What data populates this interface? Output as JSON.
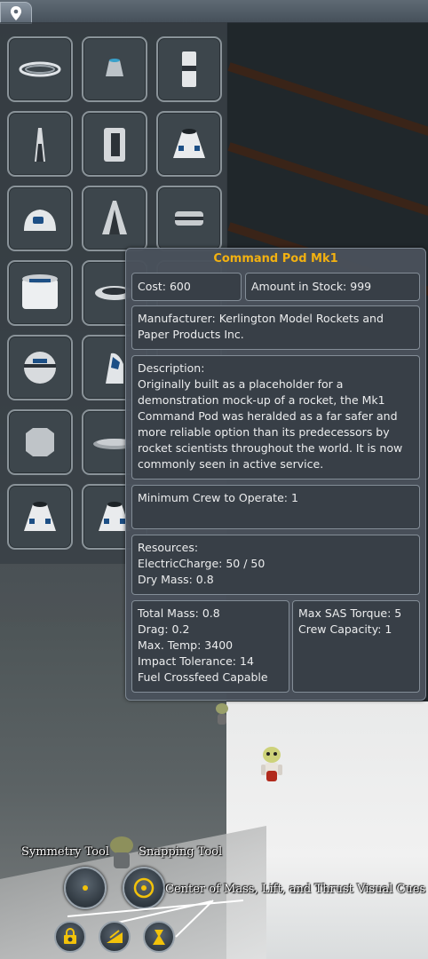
{
  "topbar": {
    "tab_icon": "map-pin-icon"
  },
  "parts": [
    {
      "name": "decoupler-ring",
      "icon": "ring"
    },
    {
      "name": "nose-cone",
      "icon": "cone-small"
    },
    {
      "name": "rcs-tank",
      "icon": "cylinder-tall"
    },
    {
      "name": "capsule-small",
      "icon": "capsule-tall"
    },
    {
      "name": "fuel-cylinder",
      "icon": "cylinder"
    },
    {
      "name": "command-pod-large",
      "icon": "pod"
    },
    {
      "name": "command-pod-lander",
      "icon": "pod-round"
    },
    {
      "name": "cockpit-cone",
      "icon": "cone"
    },
    {
      "name": "tank-disc",
      "icon": "disc"
    },
    {
      "name": "hitchhiker-module",
      "icon": "cylinder-wide"
    },
    {
      "name": "docking-ring",
      "icon": "ring-wide"
    },
    {
      "name": "",
      "icon": ""
    },
    {
      "name": "sphere-pod",
      "icon": "sphere"
    },
    {
      "name": "mk2-cockpit",
      "icon": "cockpit"
    },
    {
      "name": "",
      "icon": ""
    },
    {
      "name": "battery-pack",
      "icon": "octagon"
    },
    {
      "name": "plate",
      "icon": "plate"
    },
    {
      "name": "",
      "icon": ""
    },
    {
      "name": "command-pod-mk1",
      "icon": "pod"
    },
    {
      "name": "command-pod-mk1-alt",
      "icon": "pod"
    }
  ],
  "tooltip": {
    "title": "Command Pod Mk1",
    "cost": "Cost: 600",
    "stock": "Amount in Stock: 999",
    "manufacturer": "Manufacturer: Kerlington Model Rockets and Paper Products Inc.",
    "description_label": "Description:",
    "description": "Originally built as a placeholder for a demonstration mock-up of a rocket, the Mk1 Command Pod was heralded as a far safer and more reliable option than its predecessors by rocket scientists throughout the world. It is now commonly seen in active service.",
    "min_crew": "Minimum Crew to Operate: 1",
    "resources_label": "Resources:",
    "electric": "ElectricCharge: 50 / 50",
    "dry_mass": "Dry Mass: 0.8",
    "stats_left": [
      "Total Mass: 0.8",
      "Drag: 0.2",
      "Max. Temp: 3400",
      "Impact Tolerance: 14",
      "Fuel Crossfeed Capable"
    ],
    "stats_right": [
      "Max SAS Torque: 5",
      "Crew Capacity: 1"
    ]
  },
  "tools": {
    "symmetry_label": "Symmetry Tool",
    "snapping_label": "Snapping Tool",
    "cues_label": "Center of Mass, Lift, and Thrust Visual Cues",
    "com_icon": "center-of-mass-icon",
    "col_icon": "center-of-lift-icon",
    "cot_icon": "center-of-thrust-icon"
  },
  "colors": {
    "title": "#f2b111",
    "text": "#ecedee",
    "panel": "#49515b",
    "hangar": "#20272b"
  }
}
